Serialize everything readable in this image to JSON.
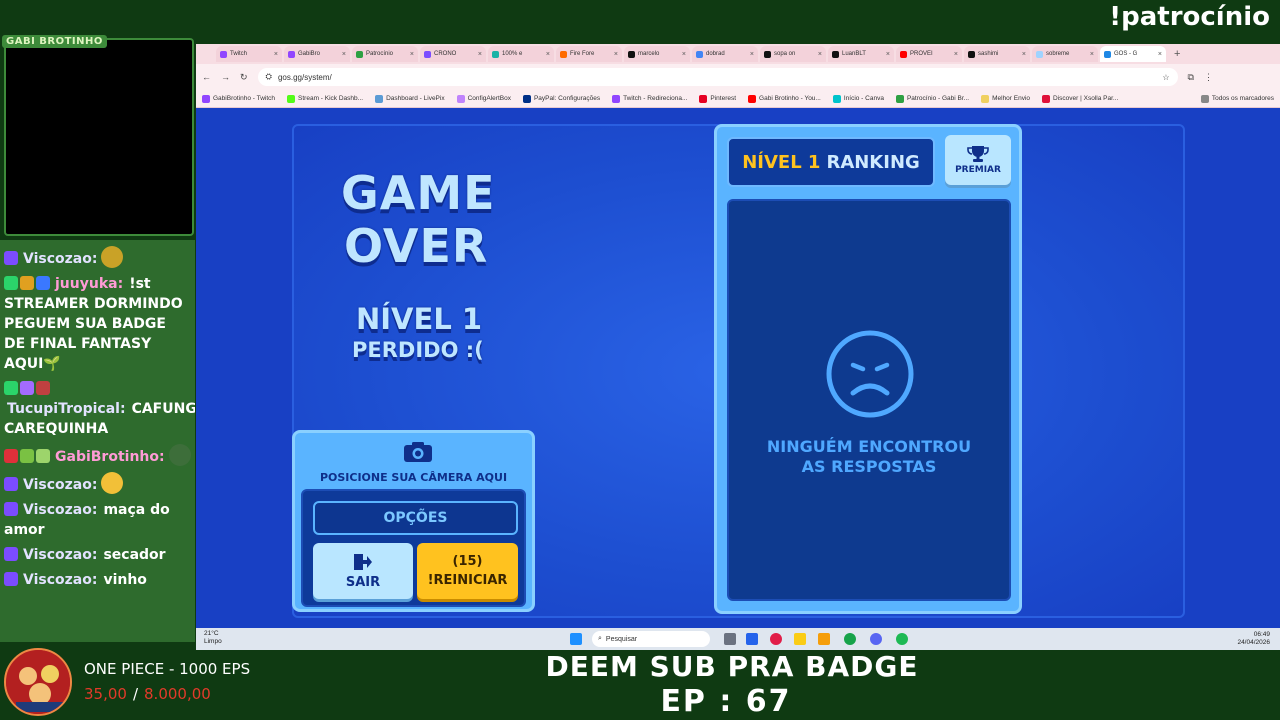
{
  "overlay": {
    "sponsor_command": "!patrocínio",
    "cam_label": "GABI BROTINHO",
    "subgoal_title": "ONE PIECE - 1000 EPS",
    "subgoal_current": "35,00",
    "subgoal_separator": "/",
    "subgoal_target": "8.000,00",
    "banner_line1": "DEEM SUB PRA BADGE",
    "banner_line2": "EP : 67"
  },
  "chat": [
    {
      "user": "Viscozao:",
      "text": "",
      "user_color": "#e2e2ff",
      "badges": [
        "#7b4cff"
      ],
      "emote": "#c9a227"
    },
    {
      "user": "juuyuka:",
      "text": "!st STREAMER DORMINDO PEGUEM SUA BADGE DE FINAL FANTASY AQUI🌱",
      "user_color": "#ff9bd6",
      "badges": [
        "#2bd46a",
        "#e0a020",
        "#3a78ff"
      ]
    },
    {
      "user": "TucupiTropical:",
      "text": "CAFUNGA CAREQUINHA",
      "user_color": "#e2e2ff",
      "badges": [
        "#2bd46a",
        "#a36bff",
        "#c04040"
      ]
    },
    {
      "user": "GabiBrotinho:",
      "text": "",
      "user_color": "#ff9bd6",
      "badges": [
        "#e0303a",
        "#7ac143",
        "#9dd46b"
      ],
      "emote": "#3d6e3a"
    },
    {
      "user": "Viscozao:",
      "text": "",
      "user_color": "#e2e2ff",
      "badges": [
        "#7b4cff"
      ],
      "emote": "#f2c038"
    },
    {
      "user": "Viscozao:",
      "text": "maça do amor",
      "user_color": "#e2e2ff",
      "badges": [
        "#7b4cff"
      ]
    },
    {
      "user": "Viscozao:",
      "text": "secador",
      "user_color": "#e2e2ff",
      "badges": [
        "#7b4cff"
      ]
    },
    {
      "user": "Viscozao:",
      "text": "vinho",
      "user_color": "#e2e2ff",
      "badges": [
        "#7b4cff"
      ]
    }
  ],
  "browser": {
    "tabs": [
      {
        "label": "Twitch",
        "color": "#9146ff"
      },
      {
        "label": "GabiBro",
        "color": "#9146ff"
      },
      {
        "label": "Patrocínio",
        "color": "#2ea043"
      },
      {
        "label": "CRONO",
        "color": "#7b4cff"
      },
      {
        "label": "100% e",
        "color": "#19b3a6"
      },
      {
        "label": "Fire Fore",
        "color": "#ff6a00"
      },
      {
        "label": "marcelo",
        "color": "#111111"
      },
      {
        "label": "dobrad",
        "color": "#4285f4"
      },
      {
        "label": "sopa on",
        "color": "#111111"
      },
      {
        "label": "LuanBLT",
        "color": "#111111"
      },
      {
        "label": "PROVEI",
        "color": "#ff0000"
      },
      {
        "label": "sashimi",
        "color": "#111111"
      },
      {
        "label": "sobreme",
        "color": "#9fd3ff"
      },
      {
        "label": "GOS - G",
        "color": "#1e88e5",
        "active": true
      }
    ],
    "url": "gos.gg/system/",
    "bookmarks": [
      {
        "label": "GabiBrotinho - Twitch",
        "color": "#9146ff"
      },
      {
        "label": "Stream - Kick Dashb...",
        "color": "#53fc18"
      },
      {
        "label": "Dashboard - LivePix",
        "color": "#5b9bd5"
      },
      {
        "label": "ConfigAlertBox",
        "color": "#c084fc"
      },
      {
        "label": "PayPal: Configurações",
        "color": "#003087"
      },
      {
        "label": "Twitch - Redireciona...",
        "color": "#9146ff"
      },
      {
        "label": "Pinterest",
        "color": "#e60023"
      },
      {
        "label": "Gabi Brotinho - You...",
        "color": "#ff0000"
      },
      {
        "label": "Início - Canva",
        "color": "#00c4cc"
      },
      {
        "label": "Patrocínio - Gabi Br...",
        "color": "#2ea043"
      },
      {
        "label": "Melhor Envio",
        "color": "#f0d060"
      },
      {
        "label": "Discover | Xsolla Par...",
        "color": "#e0103a"
      }
    ],
    "all_bookmarks": "Todos os marcadores"
  },
  "game": {
    "title_line1": "GAME",
    "title_line2": "OVER",
    "level": "NÍVEL 1",
    "lost": "PERDIDO :(",
    "camera_prompt": "POSICIONE SUA CÂMERA AQUI",
    "options_label": "OPÇÕES",
    "exit_label": "SAIR",
    "restart_count": "(15)",
    "restart_label": "!REINICIAR",
    "ranking_level": "NÍVEL 1",
    "ranking_label": "RANKING",
    "award_label": "PREMIAR",
    "empty_line1": "NINGUÉM ENCONTROU",
    "empty_line2": "AS RESPOSTAS"
  },
  "taskbar": {
    "temperature": "21°C",
    "weather": "Limpo",
    "search_placeholder": "Pesquisar",
    "time": "06:49",
    "date": "24/04/2026"
  }
}
